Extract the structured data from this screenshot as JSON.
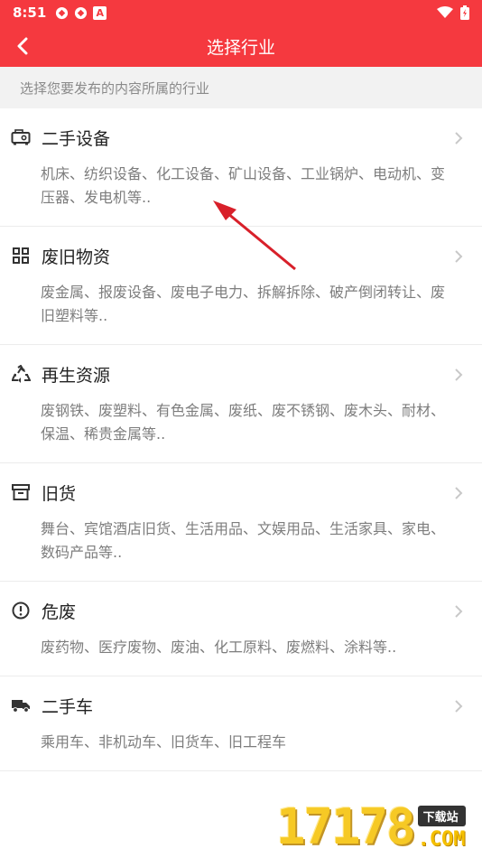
{
  "status_bar": {
    "time": "8:51",
    "notification_icons": [
      "app-badge-icon",
      "app-badge-icon",
      "a-letter-icon"
    ],
    "a_letter": "A",
    "right_icons": [
      "wifi-icon",
      "battery-icon"
    ]
  },
  "app_bar": {
    "title": "选择行业",
    "back_icon": "chevron-left-icon"
  },
  "hint": "选择您要发布的内容所属的行业",
  "categories": [
    {
      "icon": "equipment-icon",
      "title": "二手设备",
      "desc": "机床、纺织设备、化工设备、矿山设备、工业锅炉、电动机、变压器、发电机等.."
    },
    {
      "icon": "grid-icon",
      "title": "废旧物资",
      "desc": "废金属、报废设备、废电子电力、拆解拆除、破产倒闭转让、废旧塑料等.."
    },
    {
      "icon": "recycle-icon",
      "title": "再生资源",
      "desc": "废钢铁、废塑料、有色金属、废纸、废不锈钢、废木头、耐材、保温、稀贵金属等.."
    },
    {
      "icon": "archive-box-icon",
      "title": "旧货",
      "desc": "舞台、宾馆酒店旧货、生活用品、文娱用品、生活家具、家电、数码产品等.."
    },
    {
      "icon": "warning-circle-icon",
      "title": "危废",
      "desc": "废药物、医疗废物、废油、化工原料、废燃料、涂料等.."
    },
    {
      "icon": "truck-icon",
      "title": "二手车",
      "desc": "乘用车、非机动车、旧货车、旧工程车"
    }
  ],
  "watermark": {
    "number": "17178",
    "badge": "下载站",
    "domain": ".COM"
  },
  "colors": {
    "primary": "#f5393f",
    "hint_bg": "#f2f2f2",
    "annotation_arrow": "#d8202a"
  }
}
